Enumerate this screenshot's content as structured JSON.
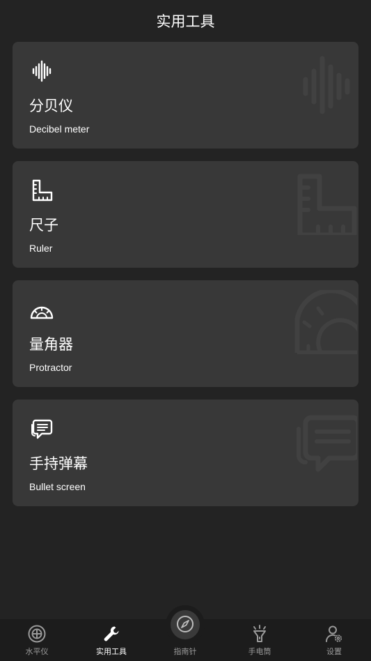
{
  "header": {
    "title": "实用工具"
  },
  "tools": [
    {
      "title": "分贝仪",
      "subtitle": "Decibel meter",
      "icon": "sound-wave-icon"
    },
    {
      "title": "尺子",
      "subtitle": "Ruler",
      "icon": "ruler-icon"
    },
    {
      "title": "量角器",
      "subtitle": "Protractor",
      "icon": "protractor-icon"
    },
    {
      "title": "手持弹幕",
      "subtitle": "Bullet screen",
      "icon": "chat-bubble-icon"
    }
  ],
  "bottom_nav": {
    "items": [
      {
        "label": "水平仪",
        "icon": "level-icon",
        "active": false
      },
      {
        "label": "实用工具",
        "icon": "wrench-icon",
        "active": true
      },
      {
        "label": "指南针",
        "icon": "compass-icon",
        "active": false
      },
      {
        "label": "手电筒",
        "icon": "flashlight-icon",
        "active": false
      },
      {
        "label": "设置",
        "icon": "user-settings-icon",
        "active": false
      }
    ]
  },
  "colors": {
    "background": "#232323",
    "card": "#383838",
    "nav_background": "#1c1c1c",
    "inactive_label": "#9a9a9a",
    "active_label": "#ffffff"
  }
}
